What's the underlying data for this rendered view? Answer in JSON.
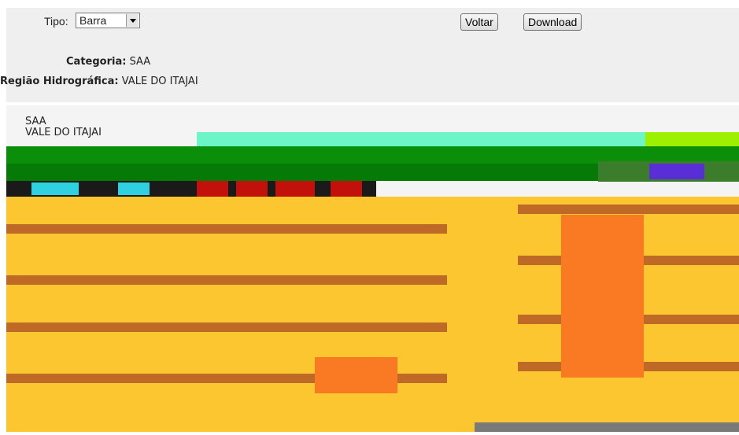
{
  "controls": {
    "tipo_label": "Tipo:",
    "tipo_value": "Barra",
    "voltar_label": "Voltar",
    "download_label": "Download"
  },
  "info": {
    "categoria_label": "Categoria:",
    "categoria_value": "SAA",
    "regiao_label": "Região Hidrográfica:",
    "regiao_value": "VALE DO ITAJAI"
  },
  "chart": {
    "title_line1": "SAA",
    "title_line2": "VALE DO ITAJAI",
    "colors": {
      "plot_background": "#fcc630",
      "bar_fill": "#f97a22",
      "grid_line": "#8a1f1f",
      "green": "#0b8f0b",
      "cyan": "#6cf6c8"
    }
  },
  "chart_data": [
    {
      "type": "bar",
      "series": [
        {
          "values": [
            0.2
          ]
        }
      ]
    },
    {
      "type": "bar",
      "series": [
        {
          "values": [
            0.9
          ]
        }
      ]
    }
  ]
}
